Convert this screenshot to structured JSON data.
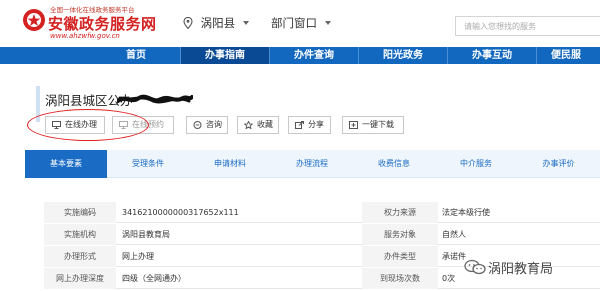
{
  "header": {
    "logo_top": "全国一体化在线政务服务平台",
    "logo_main": "安徽政务服务网",
    "logo_url": "www.ahzwfw.gov.cn",
    "location": "涡阳县",
    "department": "部门窗口",
    "search_placeholder": "请输入您想找的服务"
  },
  "nav": {
    "items": [
      {
        "label": "首页"
      },
      {
        "label": "办事指南"
      },
      {
        "label": "办件查询"
      },
      {
        "label": "阳光政务"
      },
      {
        "label": "办事互动"
      },
      {
        "label": "便民服"
      }
    ],
    "active_index": 1
  },
  "page": {
    "title": "涡阳县城区公办"
  },
  "actions": [
    {
      "label": "在线办理",
      "icon": "monitor-icon",
      "enabled": true
    },
    {
      "label": "在线预约",
      "icon": "calendar-icon",
      "enabled": false
    },
    {
      "label": "咨询",
      "icon": "chat-icon",
      "enabled": true
    },
    {
      "label": "收藏",
      "icon": "star-icon",
      "enabled": true
    },
    {
      "label": "分享",
      "icon": "share-icon",
      "enabled": true
    },
    {
      "label": "一键下载",
      "icon": "download-icon",
      "enabled": true
    }
  ],
  "tabs": [
    {
      "label": "基本要素"
    },
    {
      "label": "受理条件"
    },
    {
      "label": "申请材料"
    },
    {
      "label": "办理流程"
    },
    {
      "label": "收费信息"
    },
    {
      "label": "中介服务"
    },
    {
      "label": "办事评价"
    }
  ],
  "info_rows": [
    {
      "l1": "实施编码",
      "v1": "341621000000031765​2x111",
      "l2": "权力来源",
      "v2": "法定本级行使"
    },
    {
      "l1": "实施机构",
      "v1": "涡阳县教育局",
      "l2": "服务对象",
      "v2": "自然人"
    },
    {
      "l1": "办理形式",
      "v1": "网上办理",
      "l2": "办件类型",
      "v2": "承诺件"
    },
    {
      "l1": "网上办理深度",
      "v1": "四级（全网通办）",
      "l2": "到现场次数",
      "v2": "0次"
    }
  ],
  "watermark": "涡阳教育局",
  "colors": {
    "brand_red": "#d42121",
    "nav_blue": "#1268be",
    "nav_active": "#0a4a94",
    "tab_blue": "#1a6bc4",
    "annotation_red": "#e02020"
  }
}
